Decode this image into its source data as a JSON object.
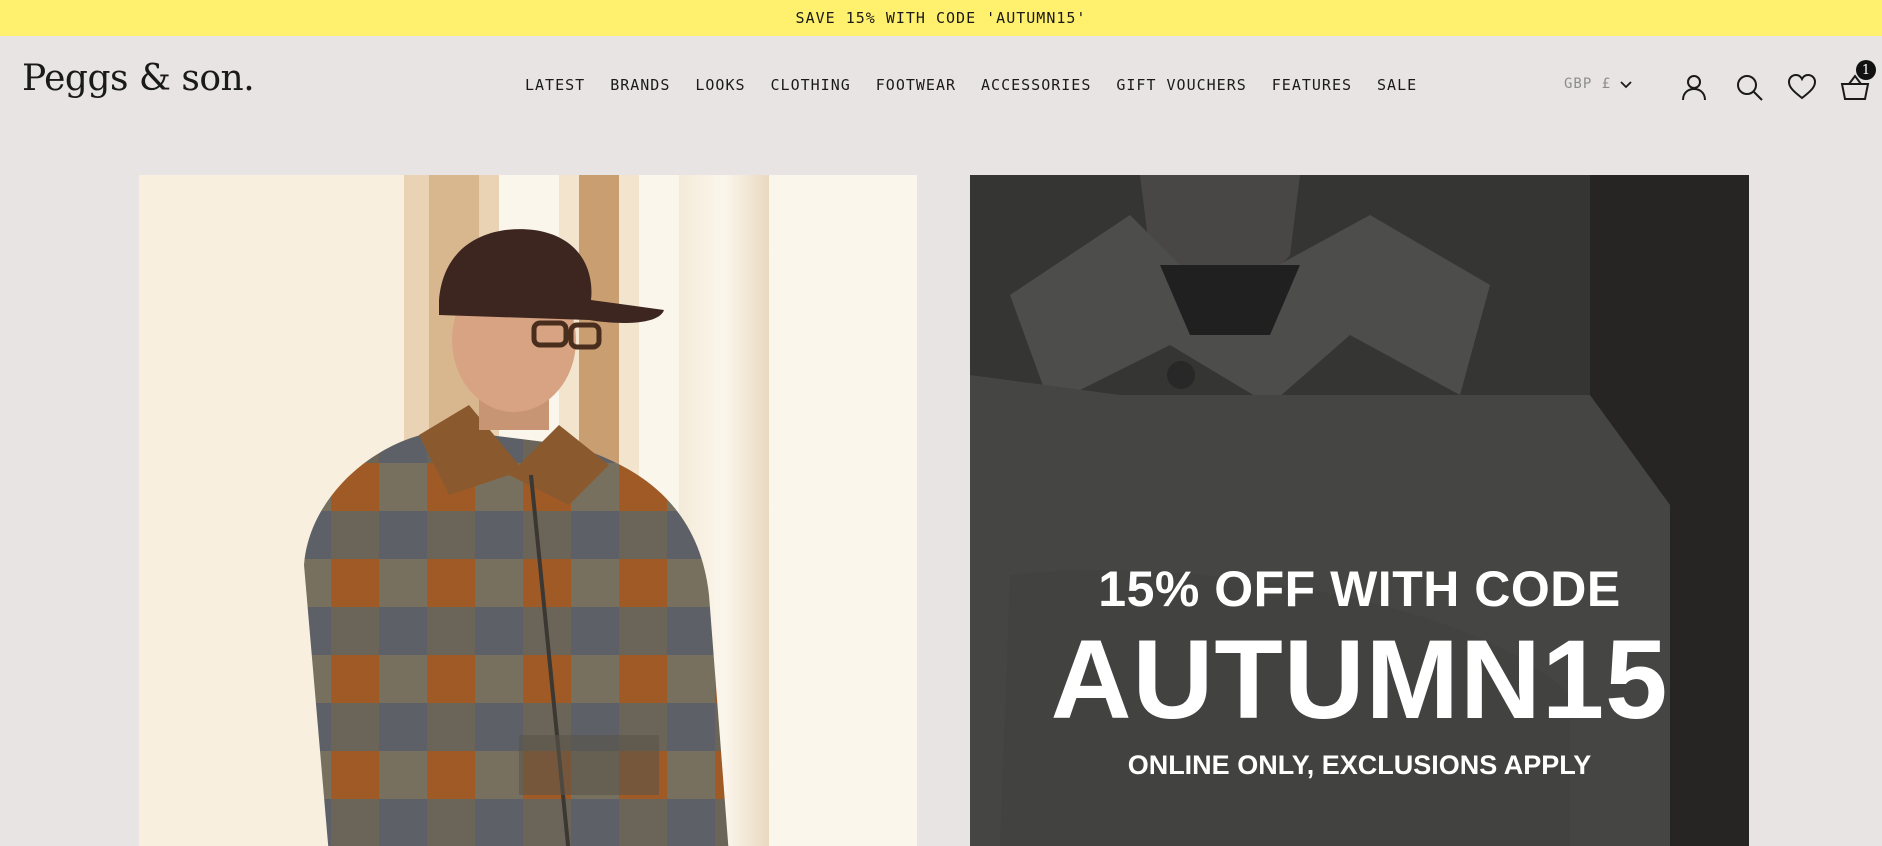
{
  "promo_bar": {
    "text": "SAVE 15% WITH CODE 'AUTUMN15'"
  },
  "header": {
    "logo": "Peggs & son.",
    "nav": [
      "LATEST",
      "BRANDS",
      "LOOKS",
      "CLOTHING",
      "FOOTWEAR",
      "ACCESSORIES",
      "GIFT VOUCHERS",
      "FEATURES",
      "SALE"
    ],
    "currency": "GBP £",
    "icons": [
      "account-icon",
      "search-icon",
      "wishlist-heart-icon",
      "basket-icon"
    ],
    "basket_count": "1"
  },
  "hero": {
    "left_image": "man-in-brown-cap-patchwork-jacket",
    "right_image": "man-in-grey-wool-overshirt",
    "promo_line1": "15% OFF WITH CODE",
    "promo_code": "AUTUMN15",
    "promo_line3": "ONLINE ONLY, EXCLUSIONS APPLY"
  },
  "colors": {
    "promo_bar": "#fff06e",
    "background": "#e8e4e3",
    "text": "#1a1a1a",
    "badge": "#111111"
  }
}
